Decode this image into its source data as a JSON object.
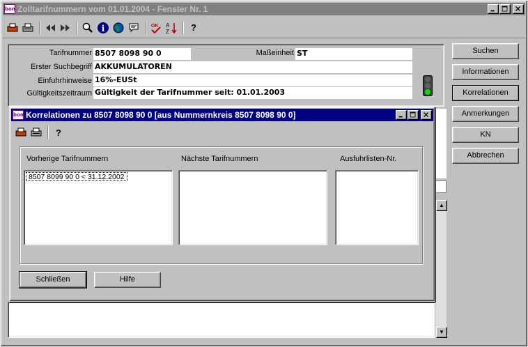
{
  "main_window": {
    "title": "Zolltarifnummern vom 01.01.2004 - Fenster Nr. 1",
    "logo_text": "bon"
  },
  "main_toolbar": {
    "icons": [
      "printer-fax-icon",
      "printer-icon",
      "rewind-icon",
      "fast-forward-icon",
      "magnifier-icon",
      "info-icon",
      "globe-icon",
      "speech-bubble-icon",
      "ok-check-icon",
      "sort-az-icon",
      "help-icon"
    ],
    "help_label": "?"
  },
  "info": {
    "tarifnummer_label": "Tarifnummer",
    "tarifnummer_value": "8507 8098 90 0",
    "masseinheit_label": "Maßeinheit",
    "masseinheit_value": "ST",
    "suchbegriff_label": "Erster Suchbegriff",
    "suchbegriff_value": "AKKUMULATOREN",
    "einfuhr_label": "Einfuhrhinweise",
    "einfuhr_value": "16%-EUSt",
    "gueltigkeit_label": "Gültigkeitszeitraum",
    "gueltigkeit_value": "Gültigkeit der Tarifnummer seit: 01.01.2003"
  },
  "traffic_light": {
    "active": "green"
  },
  "side_buttons": {
    "suchen": "Suchen",
    "informationen": "Informationen",
    "korrelationen": "Korrelationen",
    "anmerkungen": "Anmerkungen",
    "kn": "KN",
    "abbrechen": "Abbrechen"
  },
  "dialog": {
    "title": "Korrelationen zu 8507 8098 90 0 [aus Nummernkreis 8507 8098 90 0]",
    "logo_text": "bon",
    "help_label": "?",
    "col_previous": "Vorherige Tarifnummern",
    "col_next": "Nächste Tarifnummern",
    "col_ausfuhr": "Ausfuhrlisten-Nr.",
    "previous_items": [
      "8507 8099 90 0  < 31.12.2002"
    ],
    "next_items": [],
    "ausfuhr_items": [],
    "close_button": "Schließen",
    "help_button": "Hilfe"
  }
}
